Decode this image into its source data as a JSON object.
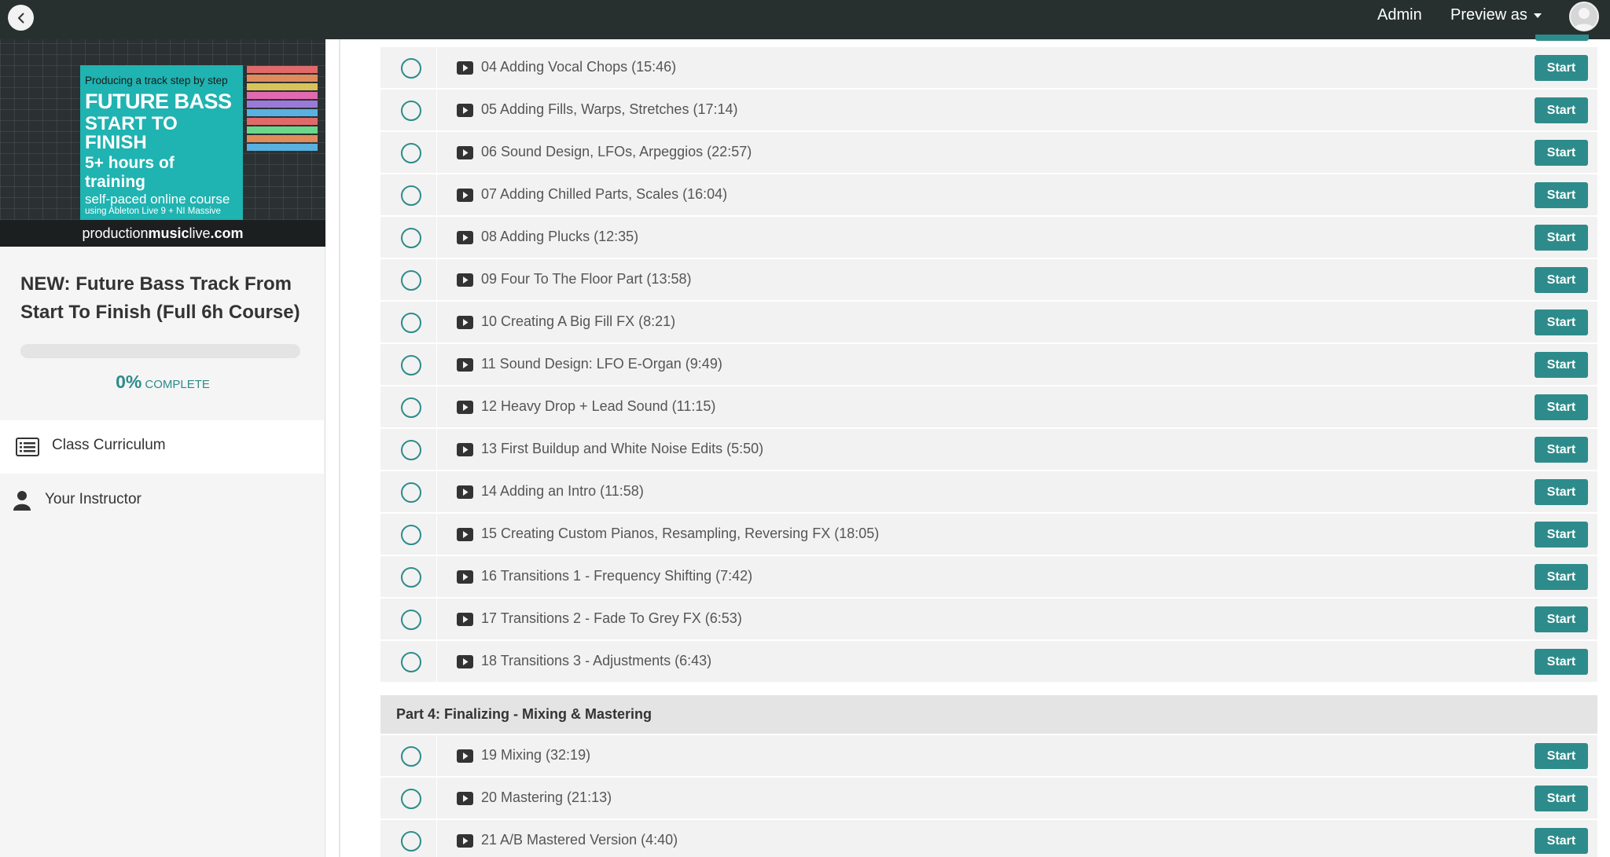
{
  "topbar": {
    "admin": "Admin",
    "preview_as": "Preview as"
  },
  "sidebar": {
    "thumbnail": {
      "line1": "Producing a track step by step",
      "line2": "FUTURE BASS",
      "line3": "START TO FINISH",
      "line4": "5+ hours of training",
      "line5": "self-paced online course",
      "line6": "using Ableton Live 9 + NI Massive",
      "footer_pre": "production",
      "footer_bold": "music",
      "footer_mid": "live",
      "footer_post": ".com"
    },
    "course_title": "NEW: Future Bass Track From Start To Finish (Full 6h Course)",
    "progress": {
      "percent_label": "0%",
      "complete_label": "COMPLETE",
      "value": 0
    },
    "nav": [
      {
        "label": "Class Curriculum",
        "icon": "list-icon"
      },
      {
        "label": "Your Instructor",
        "icon": "user-icon"
      }
    ]
  },
  "curriculum": {
    "start_label": "Start",
    "lectures": [
      "04 Adding Vocal Chops (15:46)",
      "05 Adding Fills, Warps, Stretches (17:14)",
      "06 Sound Design, LFOs, Arpeggios (22:57)",
      "07 Adding Chilled Parts, Scales (16:04)",
      "08 Adding Plucks (12:35)",
      "09 Four To The Floor Part (13:58)",
      "10 Creating A Big Fill FX (8:21)",
      "11 Sound Design: LFO E-Organ (9:49)",
      "12 Heavy Drop + Lead Sound (11:15)",
      "13 First Buildup and White Noise Edits (5:50)",
      "14 Adding an Intro (11:58)",
      "15 Creating Custom Pianos, Resampling, Reversing FX (18:05)",
      "16 Transitions 1 - Frequency Shifting (7:42)",
      "17 Transitions 2 - Fade To Grey FX (6:53)",
      "18 Transitions 3 - Adjustments (6:43)"
    ],
    "section_title": "Part 4: Finalizing - Mixing & Mastering",
    "section_lectures": [
      "19 Mixing (32:19)",
      "20 Mastering (21:13)",
      "21 A/B Mastered Version (4:40)"
    ]
  },
  "colors": {
    "accent": "#2e8b8b",
    "topbar": "#27302f",
    "row_bg": "#f2f2f2",
    "promo": "#1fb3b1"
  }
}
